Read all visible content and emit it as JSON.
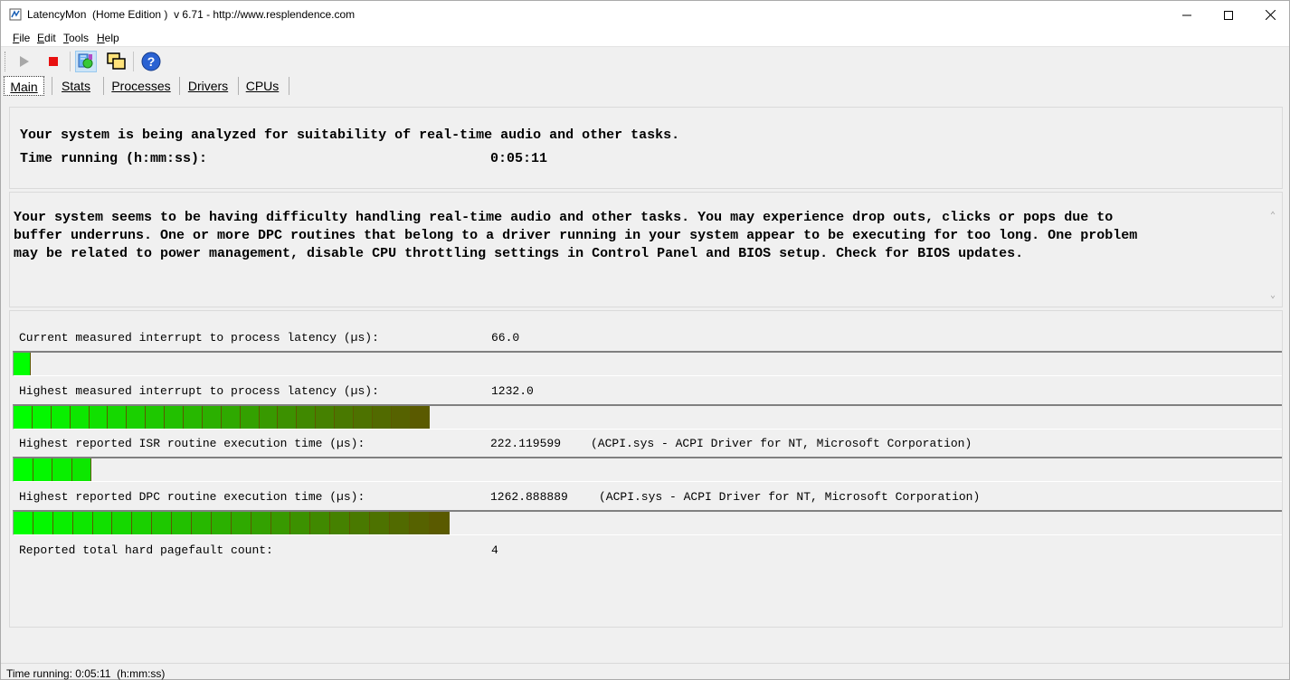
{
  "window": {
    "title": "LatencyMon  (Home Edition )  v 6.71 - http://www.resplendence.com"
  },
  "menu": [
    {
      "key": "F",
      "rest": "ile"
    },
    {
      "key": "E",
      "rest": "dit"
    },
    {
      "key": "T",
      "rest": "ools"
    },
    {
      "key": "H",
      "rest": "elp"
    }
  ],
  "toolbar": {
    "icons": [
      "play-icon",
      "stop-icon",
      "analyze-icon",
      "windows-icon",
      "help-icon"
    ]
  },
  "tabs": [
    {
      "label": "Main",
      "active": true
    },
    {
      "label": "Stats"
    },
    {
      "label": "Processes"
    },
    {
      "label": "Drivers"
    },
    {
      "label": "CPUs"
    }
  ],
  "status_panel": {
    "line1": "Your system is being analyzed for suitability of real-time audio and other tasks.",
    "line2": "Time running (h:mm:ss):",
    "time_value": "0:05:11"
  },
  "conclusion": {
    "line1": "Your system seems to be having difficulty handling real-time audio and other tasks. You may experience drop outs, clicks or pops due to",
    "line2": "buffer underruns. One or more DPC routines that belong to a driver running in your system appear to be executing for too long. One problem",
    "line3": "may be related to power management, disable CPU throttling settings in Control Panel and BIOS setup. Check for BIOS updates."
  },
  "metrics": [
    {
      "label": "Current measured interrupt to process latency (µs):",
      "value": "66.0",
      "detail": "",
      "bar_segments": 1
    },
    {
      "label": "Highest measured interrupt to process latency (µs):",
      "value": "1232.0",
      "detail": "",
      "bar_segments": 22
    },
    {
      "label": "Highest reported ISR routine execution time (µs):",
      "value": "222.119599",
      "detail": "(ACPI.sys - ACPI Driver for NT, Microsoft Corporation)",
      "bar_segments": 4
    },
    {
      "label": "Highest reported DPC routine execution time (µs):",
      "value": "1262.888889",
      "detail": "(ACPI.sys - ACPI Driver for NT, Microsoft Corporation)",
      "bar_segments": 22
    }
  ],
  "pagefault": {
    "label": "Reported total hard pagefault count:",
    "value": "4"
  },
  "statusbar": {
    "text": "Time running: 0:05:11  (h:mm:ss)"
  },
  "colors": {
    "bar_start": "#00ff00",
    "bar_end": "#5a5a00",
    "stop": "#e81010"
  }
}
